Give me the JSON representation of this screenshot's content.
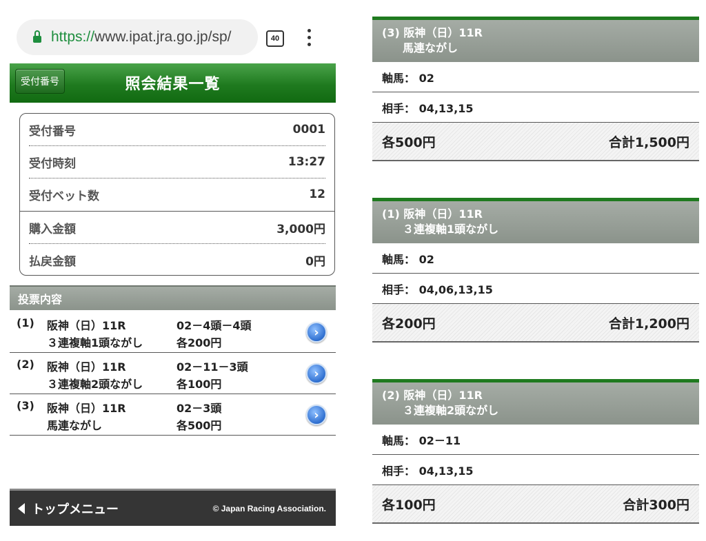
{
  "browser": {
    "url_scheme": "https://",
    "url_rest": "www.ipat.jra.go.jp/sp/",
    "tab_count": "40"
  },
  "header": {
    "back_label": "受付番号",
    "title": "照会結果一覧"
  },
  "info": {
    "rows": [
      {
        "label": "受付番号",
        "value": "0001"
      },
      {
        "label": "受付時刻",
        "value": "13:27"
      },
      {
        "label": "受付ベット数",
        "value": "12"
      },
      {
        "label": "購入金額",
        "value": "3,000円"
      },
      {
        "label": "払戻金額",
        "value": "0円"
      }
    ]
  },
  "bets_section": {
    "title": "投票内容",
    "items": [
      {
        "num": "(1)",
        "race": "阪神（日）11R",
        "type": "３連複軸1頭ながし",
        "combo": "02－4頭－4頭",
        "unit": "各200円"
      },
      {
        "num": "(2)",
        "race": "阪神（日）11R",
        "type": "３連複軸2頭ながし",
        "combo": "02－11－3頭",
        "unit": "各100円"
      },
      {
        "num": "(3)",
        "race": "阪神（日）11R",
        "type": "馬連ながし",
        "combo": "02－3頭",
        "unit": "各500円"
      }
    ]
  },
  "footer": {
    "menu_label": "トップメニュー",
    "copyright": "© Japan Racing Association."
  },
  "details": [
    {
      "title": "(3) 阪神（日）11R",
      "subtitle": "馬連ながし",
      "axis": "軸馬： 02",
      "partner": "相手： 04,13,15",
      "unit": "各500円",
      "total": "合計1,500円"
    },
    {
      "title": "(1) 阪神（日）11R",
      "subtitle": "３連複軸1頭ながし",
      "axis": "軸馬： 02",
      "partner": "相手： 04,06,13,15",
      "unit": "各200円",
      "total": "合計1,200円"
    },
    {
      "title": "(2) 阪神（日）11R",
      "subtitle": "３連複軸2頭ながし",
      "axis": "軸馬： 02－11",
      "partner": "相手： 04,13,15",
      "unit": "各100円",
      "total": "合計300円"
    }
  ]
}
